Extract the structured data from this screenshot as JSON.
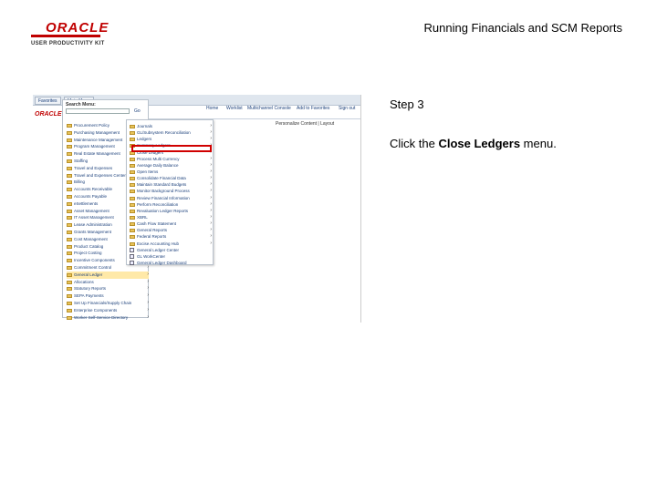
{
  "header": {
    "logo_main": "ORACLE",
    "logo_sub": "USER PRODUCTIVITY KIT",
    "title": "Running Financials and SCM Reports"
  },
  "panel": {
    "step": "Step 3",
    "instruction_prefix": "Click the ",
    "instruction_target": "Close Ledgers",
    "instruction_suffix": " menu."
  },
  "screenshot": {
    "tabs": [
      "Favorites",
      "Main Menu"
    ],
    "brand": "ORACLE",
    "search_label": "Search Menu:",
    "go": "Go",
    "nav": [
      "Home",
      "Worklist",
      "Multichannel Console",
      "Add to Favorites",
      "Sign out"
    ],
    "personalize": "Personalize Content | Layout",
    "left_items": [
      "Procurement Policy",
      "Purchasing Management",
      "Maintenance Management",
      "Program Management",
      "Real Estate Management",
      "Staffing",
      "Travel and Expenses",
      "Travel and Expenses Center",
      "Billing",
      "Accounts Receivable",
      "Accounts Payable",
      "eSettlements",
      "Asset Management",
      "IT Asset Management",
      "Lease Administration",
      "Grants Management",
      "Cost Management",
      "Product Catalog",
      "Project Costing",
      "Incentive Components",
      "Commitment Control",
      "General Ledger",
      "Allocations",
      "Statutory Reports",
      "SEPA Payments",
      "Set Up Financials/Supply Chain",
      "Enterprise Components",
      "Worker Self-Service Directory"
    ],
    "right_items": [
      "Journals",
      "GL/Subsystem Reconciliation",
      "Ledgers",
      "Summary Ledgers",
      "Close Ledgers",
      "Process Multi Currency",
      "Average Daily Balance",
      "Open Items",
      "Consolidate Financial Data",
      "Maintain Standard Budgets",
      "Monitor Background Process",
      "Review Financial Information",
      "Perform Reconciliation",
      "Revaluation Ledger Reports",
      "XBRL",
      "Cash Flow Statement",
      "General Reports",
      "Federal Reports",
      "Excise Accounting Hub",
      "General Ledger Center",
      "GL WorkCenter",
      "General Ledger Dashboard"
    ]
  }
}
